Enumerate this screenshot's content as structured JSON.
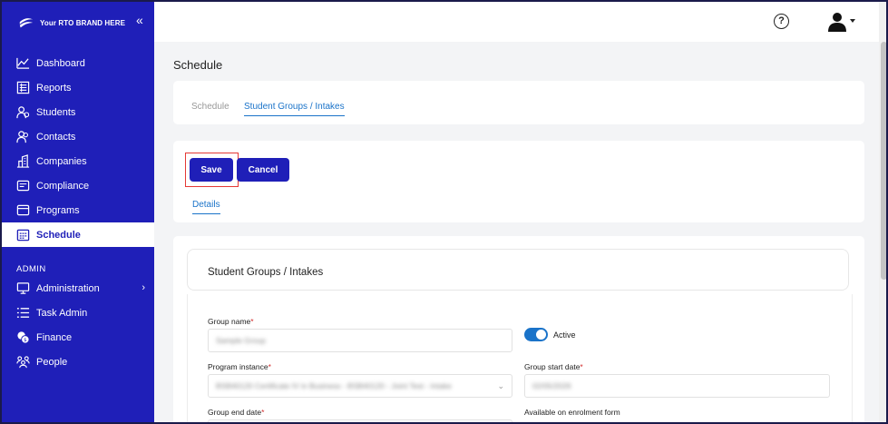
{
  "brand": {
    "name": "Your RTO BRAND HERE",
    "collapse_glyph": "«"
  },
  "sidebar": {
    "items": [
      {
        "label": "Dashboard",
        "icon": "dashboard-icon"
      },
      {
        "label": "Reports",
        "icon": "reports-icon"
      },
      {
        "label": "Students",
        "icon": "students-icon"
      },
      {
        "label": "Contacts",
        "icon": "contacts-icon"
      },
      {
        "label": "Companies",
        "icon": "companies-icon"
      },
      {
        "label": "Compliance",
        "icon": "compliance-icon"
      },
      {
        "label": "Programs",
        "icon": "programs-icon"
      },
      {
        "label": "Schedule",
        "icon": "schedule-icon",
        "active": true
      }
    ],
    "admin_section": "ADMIN",
    "admin_items": [
      {
        "label": "Administration",
        "icon": "administration-icon",
        "has_submenu": true
      },
      {
        "label": "Task Admin",
        "icon": "task-admin-icon"
      },
      {
        "label": "Finance",
        "icon": "finance-icon"
      },
      {
        "label": "People",
        "icon": "people-icon"
      }
    ]
  },
  "topbar": {
    "help_glyph": "?",
    "user_icon": "user-icon"
  },
  "page": {
    "title": "Schedule"
  },
  "tabs": [
    {
      "label": "Schedule",
      "active": false
    },
    {
      "label": "Student Groups / Intakes",
      "active": true
    }
  ],
  "actions": {
    "save_label": "Save",
    "cancel_label": "Cancel",
    "details_tab": "Details"
  },
  "form": {
    "section_title": "Student Groups / Intakes",
    "group_name": {
      "label": "Group name",
      "required_mark": "*",
      "value": "Sample Group"
    },
    "active_toggle": {
      "label": "Active",
      "on": true
    },
    "program_instance": {
      "label": "Program instance",
      "required_mark": "*",
      "value": "BSB40120 Certificate IV in Business - BSB40120 - Joint Test - Intake"
    },
    "group_start_date": {
      "label": "Group start date",
      "required_mark": "*",
      "value": "02/05/2026"
    },
    "group_end_date": {
      "label": "Group end date",
      "required_mark": "*"
    },
    "enrolment_form": {
      "label": "Available on enrolment form"
    }
  },
  "colors": {
    "sidebar": "#1f1fb8",
    "accent": "#1a73c9",
    "highlight": "#e53935"
  }
}
